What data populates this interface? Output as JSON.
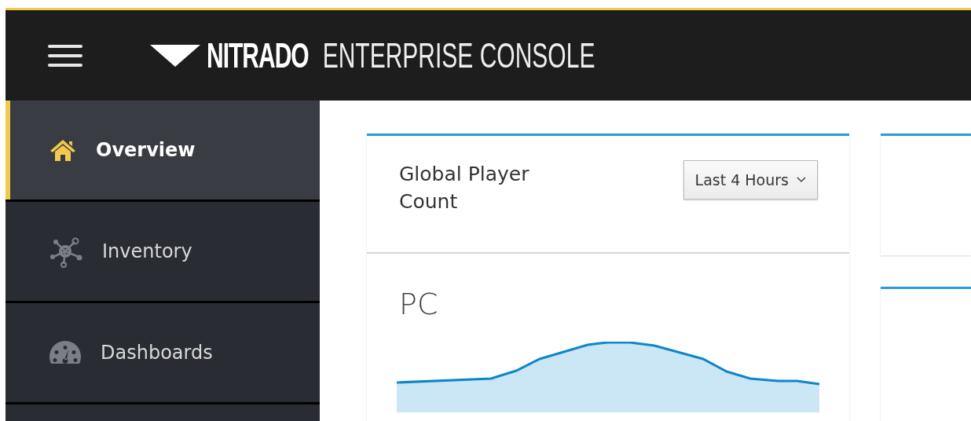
{
  "header": {
    "brand": "NITRADO",
    "product": "ENTERPRISE CONSOLE"
  },
  "sidebar": {
    "items": [
      {
        "label": "Overview",
        "kind": "home",
        "selected": true
      },
      {
        "label": "Inventory",
        "kind": "network",
        "selected": false
      },
      {
        "label": "Dashboards",
        "kind": "gauge",
        "selected": false
      }
    ]
  },
  "card": {
    "title": "Global Player Count",
    "range_button": "Last 4 Hours",
    "section": "PC"
  }
}
